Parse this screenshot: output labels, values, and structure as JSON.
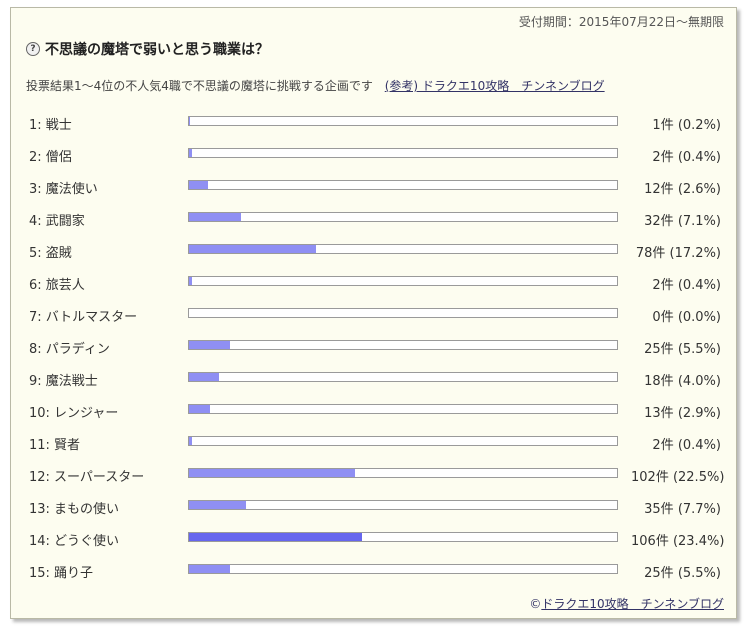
{
  "header": {
    "period": "受付期間：2015年07月22日～無期限",
    "title": "不思議の魔塔で弱いと思う職業は？",
    "description": "投票結果1～4位の不人気4職で不思議の魔塔に挑戦する企画です",
    "ref_link": "(参考) ドラクエ10攻略　チンネンブログ"
  },
  "results": [
    {
      "label": "1: 戦士",
      "count": "1件 (0.2%)",
      "percent": 0.2
    },
    {
      "label": "2: 僧侶",
      "count": "2件 (0.4%)",
      "percent": 0.4
    },
    {
      "label": "3: 魔法使い",
      "count": "12件 (2.6%)",
      "percent": 2.6
    },
    {
      "label": "4: 武闘家",
      "count": "32件 (7.1%)",
      "percent": 7.1
    },
    {
      "label": "5: 盗賊",
      "count": "78件 (17.2%)",
      "percent": 17.2
    },
    {
      "label": "6: 旅芸人",
      "count": "2件 (0.4%)",
      "percent": 0.4
    },
    {
      "label": "7: バトルマスター",
      "count": "0件 (0.0%)",
      "percent": 0.0
    },
    {
      "label": "8: パラディン",
      "count": "25件 (5.5%)",
      "percent": 5.5
    },
    {
      "label": "9: 魔法戦士",
      "count": "18件 (4.0%)",
      "percent": 4.0
    },
    {
      "label": "10: レンジャー",
      "count": "13件 (2.9%)",
      "percent": 2.9
    },
    {
      "label": "11: 賢者",
      "count": "2件 (0.4%)",
      "percent": 0.4
    },
    {
      "label": "12: スーパースター",
      "count": "102件 (22.5%)",
      "percent": 22.5
    },
    {
      "label": "13: まもの使い",
      "count": "35件 (7.7%)",
      "percent": 7.7
    },
    {
      "label": "14: どうぐ使い",
      "count": "106件 (23.4%)",
      "percent": 23.4
    },
    {
      "label": "15: 踊り子",
      "count": "25件 (5.5%)",
      "percent": 5.5
    }
  ],
  "bar_scale_max_percent": 58,
  "colors": {
    "bar_fill": "#8f8ff3",
    "bar_fill_top": "#6666ee",
    "panel_bg": "#fdfdf0"
  },
  "footer": {
    "copyright_symbol": "©",
    "copyright_link": "ドラクエ10攻略　チンネンブログ"
  }
}
